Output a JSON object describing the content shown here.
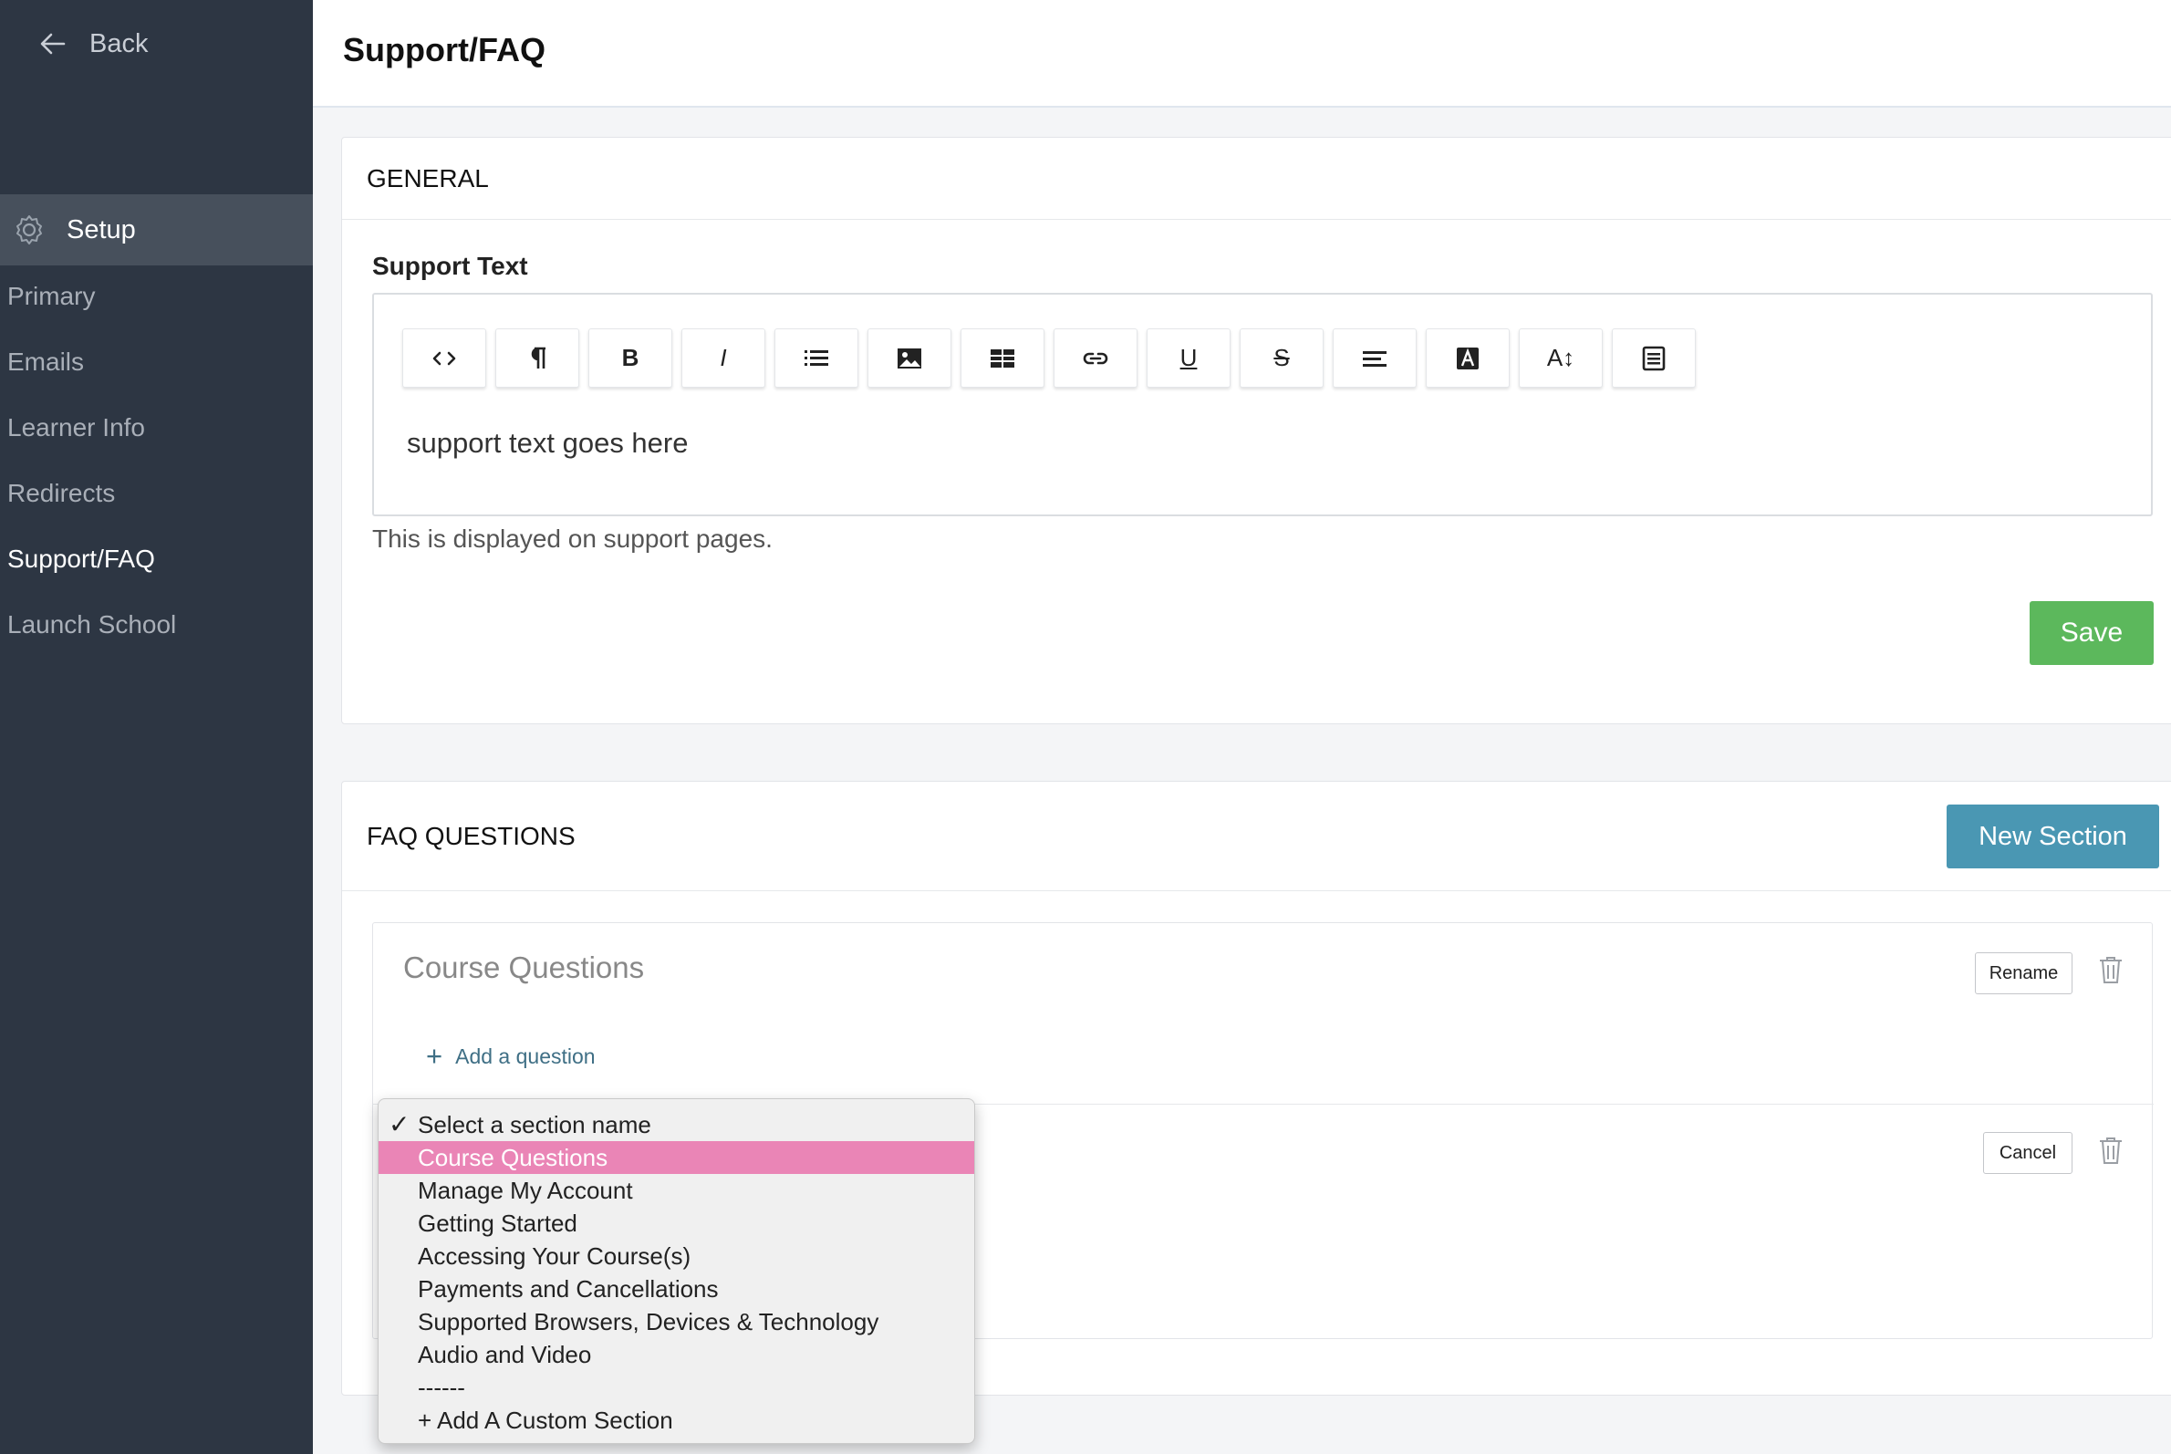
{
  "sidebar": {
    "back_label": "Back",
    "section_label": "Setup",
    "items": [
      {
        "label": "Primary"
      },
      {
        "label": "Emails"
      },
      {
        "label": "Learner Info"
      },
      {
        "label": "Redirects"
      },
      {
        "label": "Support/FAQ"
      },
      {
        "label": "Launch School"
      }
    ],
    "active_item": "Support/FAQ"
  },
  "header": {
    "title": "Support/FAQ"
  },
  "general": {
    "heading": "GENERAL",
    "support_label": "Support Text",
    "toolbar": [
      "code-view",
      "paragraph-format",
      "bold",
      "italic",
      "list",
      "image",
      "table",
      "link",
      "underline",
      "strikethrough",
      "align",
      "text-color",
      "font-size",
      "html-blocks"
    ],
    "toolbar_text": {
      "bold": "B",
      "italic": "I",
      "underline": "U",
      "strike": "S",
      "font_size": "A↕"
    },
    "content": "support text goes here",
    "help_text": "This is displayed on support pages.",
    "save_label": "Save"
  },
  "faq": {
    "heading": "FAQ QUESTIONS",
    "new_section_label": "New Section",
    "section": {
      "name": "Course Questions",
      "rename_label": "Rename",
      "add_question_label": "Add a question",
      "cancel_label": "Cancel"
    },
    "dropdown": {
      "selected_index": 0,
      "highlighted_index": 1,
      "options": [
        "Select a section name",
        "Course Questions",
        "Manage My Account",
        "Getting Started",
        "Accessing Your Course(s)",
        "Payments and Cancellations",
        "Supported Browsers, Devices & Technology",
        "Audio and Video",
        "------",
        "+ Add A Custom Section"
      ]
    }
  },
  "colors": {
    "sidebar_bg": "#2d3643",
    "save_green": "#5cb85c",
    "new_section_blue": "#4a97b3",
    "highlight_pink": "#ea85b6"
  }
}
